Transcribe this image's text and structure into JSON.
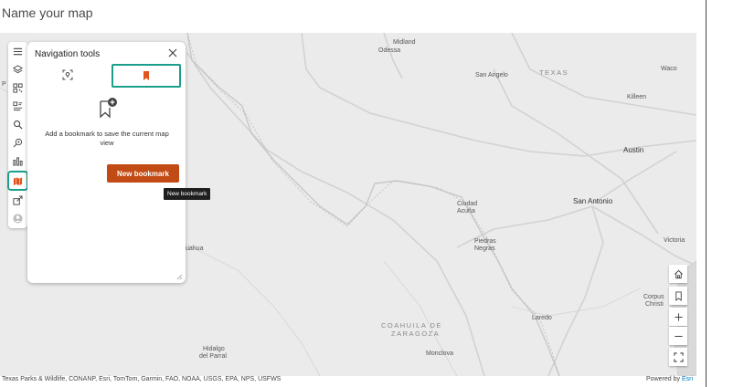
{
  "page": {
    "title": "Name your map"
  },
  "map": {
    "places": [
      {
        "name": "Midland",
        "cls": ""
      },
      {
        "name": "Odessa",
        "cls": ""
      },
      {
        "name": "San Angelo",
        "cls": ""
      },
      {
        "name": "TEXAS",
        "cls": "region"
      },
      {
        "name": "Waco",
        "cls": ""
      },
      {
        "name": "Killeen",
        "cls": ""
      },
      {
        "name": "Austin",
        "cls": "big"
      },
      {
        "name": "San Antonio",
        "cls": "big"
      },
      {
        "name": "Ciudad",
        "cls": ""
      },
      {
        "name": "Acuña",
        "cls": ""
      },
      {
        "name": "Piedras",
        "cls": ""
      },
      {
        "name": "Negras",
        "cls": ""
      },
      {
        "name": "Victoria",
        "cls": ""
      },
      {
        "name": "Corpus",
        "cls": ""
      },
      {
        "name": "Christi",
        "cls": ""
      },
      {
        "name": "Laredo",
        "cls": ""
      },
      {
        "name": "COAHUILA DE",
        "cls": "region"
      },
      {
        "name": "ZARAGOZA",
        "cls": "region"
      },
      {
        "name": "Monclova",
        "cls": ""
      },
      {
        "name": "Hidalgo",
        "cls": ""
      },
      {
        "name": "del Parral",
        "cls": ""
      },
      {
        "name": "uahua",
        "cls": ""
      },
      {
        "name": "P",
        "cls": ""
      }
    ],
    "attribution": "Texas Parks & Wildlife, CONANP, Esri, TomTom, Garmin, FAO, NOAA, USGS, EPA, NPS, USFWS",
    "powered_by": "Powered by ",
    "powered_by_brand": "Esri"
  },
  "toolbar": {
    "items": [
      {
        "name": "menu-icon"
      },
      {
        "name": "layers-icon"
      },
      {
        "name": "qr-code-icon"
      },
      {
        "name": "legend-icon"
      },
      {
        "name": "search-icon"
      },
      {
        "name": "location-tag-icon"
      },
      {
        "name": "chart-icon"
      },
      {
        "name": "map-bookmark-icon",
        "active": true
      },
      {
        "name": "share-icon"
      },
      {
        "name": "user-avatar-icon"
      }
    ]
  },
  "panel": {
    "title": "Navigation tools",
    "empty_text": "Add a bookmark to save the current map view",
    "new_bookmark_label": "New bookmark",
    "tooltip": "New bookmark"
  },
  "colors": {
    "accent": "#1aa08a",
    "brand_button": "#c24b15",
    "map_bg": "#ebebeb"
  }
}
